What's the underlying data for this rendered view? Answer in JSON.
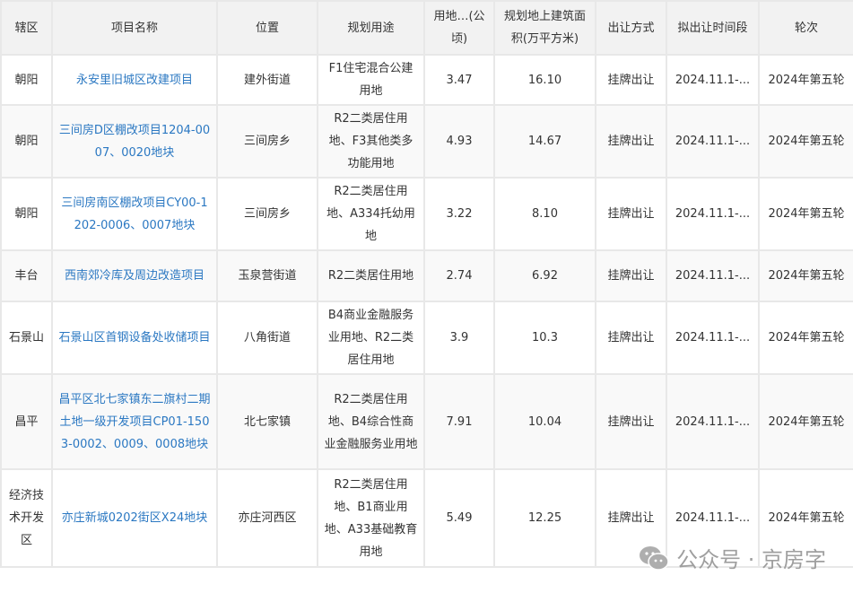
{
  "headers": [
    "辖区",
    "项目名称",
    "位置",
    "规划用途",
    "用地…(公顷)",
    "规划地上建筑面积(万平方米)",
    "出让方式",
    "拟出让时间段",
    "轮次"
  ],
  "rows": [
    {
      "district": "朝阳",
      "project": "永安里旧城区改建项目",
      "location": "建外街道",
      "use": "F1住宅混合公建用地",
      "area": "3.47",
      "floor_area": "16.10",
      "method": "挂牌出让",
      "period": "2024.11.1-...",
      "round": "2024年第五轮"
    },
    {
      "district": "朝阳",
      "project": "三间房D区棚改项目1204-0007、0020地块",
      "location": "三间房乡",
      "use": "R2二类居住用地、F3其他类多功能用地",
      "area": "4.93",
      "floor_area": "14.67",
      "method": "挂牌出让",
      "period": "2024.11.1-...",
      "round": "2024年第五轮"
    },
    {
      "district": "朝阳",
      "project": "三间房南区棚改项目CY00-1202-0006、0007地块",
      "location": "三间房乡",
      "use": "R2二类居住用地、A334托幼用地",
      "area": "3.22",
      "floor_area": "8.10",
      "method": "挂牌出让",
      "period": "2024.11.1-...",
      "round": "2024年第五轮"
    },
    {
      "district": "丰台",
      "project": "西南郊冷库及周边改造项目",
      "location": "玉泉营街道",
      "use": "R2二类居住用地",
      "area": "2.74",
      "floor_area": "6.92",
      "method": "挂牌出让",
      "period": "2024.11.1-...",
      "round": "2024年第五轮"
    },
    {
      "district": "石景山",
      "project": "石景山区首钢设备处收储项目",
      "location": "八角街道",
      "use": "B4商业金融服务业用地、R2二类居住用地",
      "area": "3.9",
      "floor_area": "10.3",
      "method": "挂牌出让",
      "period": "2024.11.1-...",
      "round": "2024年第五轮"
    },
    {
      "district": "昌平",
      "project": "昌平区北七家镇东二旗村二期土地一级开发项目CP01-1503-0002、0009、0008地块",
      "location": "北七家镇",
      "use": "R2二类居住用地、B4综合性商业金融服务业用地",
      "area": "7.91",
      "floor_area": "10.04",
      "method": "挂牌出让",
      "period": "2024.11.1-...",
      "round": "2024年第五轮"
    },
    {
      "district": "经济技术开发区",
      "project": "亦庄新城0202街区X24地块",
      "location": "亦庄河西区",
      "use": "R2二类居住用地、B1商业用地、A33基础教育用地",
      "area": "5.49",
      "floor_area": "12.25",
      "method": "挂牌出让",
      "period": "2024.11.1-...",
      "round": "2024年第五轮"
    }
  ],
  "watermark": "公众号 · 京房字",
  "colors": {
    "link": "#2b78c2",
    "header_bg": "#f2f2f2",
    "border": "#e8e8e8"
  }
}
